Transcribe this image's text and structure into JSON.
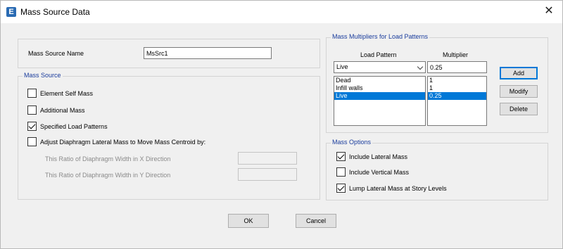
{
  "window": {
    "title": "Mass Source Data",
    "close_glyph": "✕",
    "icon_letter": "E"
  },
  "mass_source_name": {
    "label": "Mass Source Name",
    "value": "MsSrc1"
  },
  "mass_source": {
    "title": "Mass Source",
    "element_self_mass": "Element Self Mass",
    "additional_mass": "Additional Mass",
    "specified_load_patterns": "Specified Load Patterns",
    "adjust_diaphragm": "Adjust Diaphragm Lateral Mass to Move Mass Centroid by:",
    "ratio_x": "This Ratio of Diaphragm Width in X Direction",
    "ratio_y": "This Ratio of Diaphragm Width in Y Direction"
  },
  "multipliers": {
    "title": "Mass Multipliers for Load Patterns",
    "col_load_pattern": "Load Pattern",
    "col_multiplier": "Multiplier",
    "selected_pattern": "Live",
    "multiplier_value": "0.25",
    "rows": [
      {
        "pattern": "Dead",
        "multiplier": "1"
      },
      {
        "pattern": "Infill walls",
        "multiplier": "1"
      },
      {
        "pattern": "Live",
        "multiplier": "0.25"
      }
    ],
    "add": "Add",
    "modify": "Modify",
    "delete": "Delete"
  },
  "mass_options": {
    "title": "Mass Options",
    "include_lateral": "Include Lateral Mass",
    "include_vertical": "Include Vertical Mass",
    "lump_lateral": "Lump Lateral Mass at Story Levels"
  },
  "footer": {
    "ok": "OK",
    "cancel": "Cancel"
  }
}
